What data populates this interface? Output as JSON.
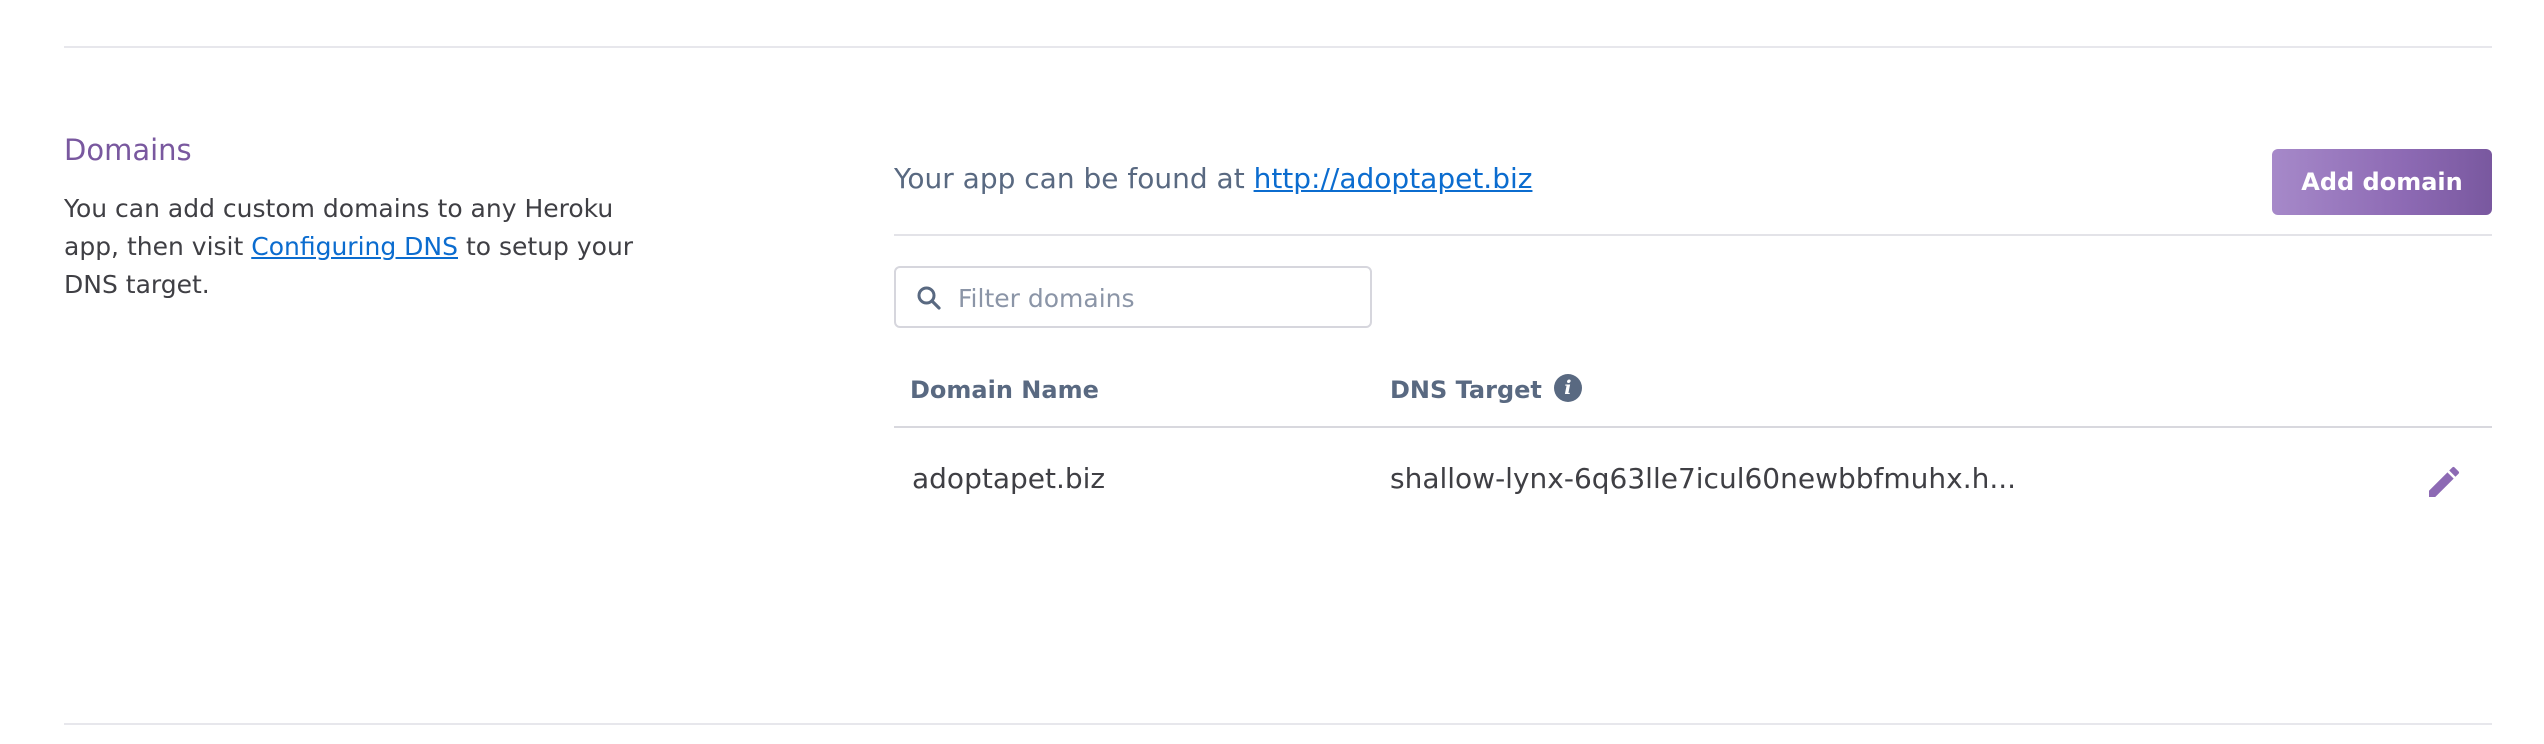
{
  "domains_section": {
    "title": "Domains",
    "description_before_link": "You can add custom domains to any Heroku app, then visit ",
    "description_link": "Configuring DNS",
    "description_after_link": " to setup your DNS target."
  },
  "app_url": {
    "prefix": "Your app can be found at ",
    "link": "http://adoptapet.biz"
  },
  "add_domain_button": "Add domain",
  "filter": {
    "placeholder": "Filter domains",
    "value": ""
  },
  "table": {
    "columns": [
      "Domain Name",
      "DNS Target"
    ],
    "rows": [
      {
        "domain_name": "adoptapet.biz",
        "dns_target": "shallow-lynx-6q63lle7icul60newbbfmuhx.h..."
      }
    ]
  },
  "icons": {
    "search": "search-icon",
    "info": "info-icon",
    "edit": "pencil-icon"
  },
  "colors": {
    "accent": "#79589f",
    "link": "#0b6ccf",
    "muted_text": "#596981"
  }
}
